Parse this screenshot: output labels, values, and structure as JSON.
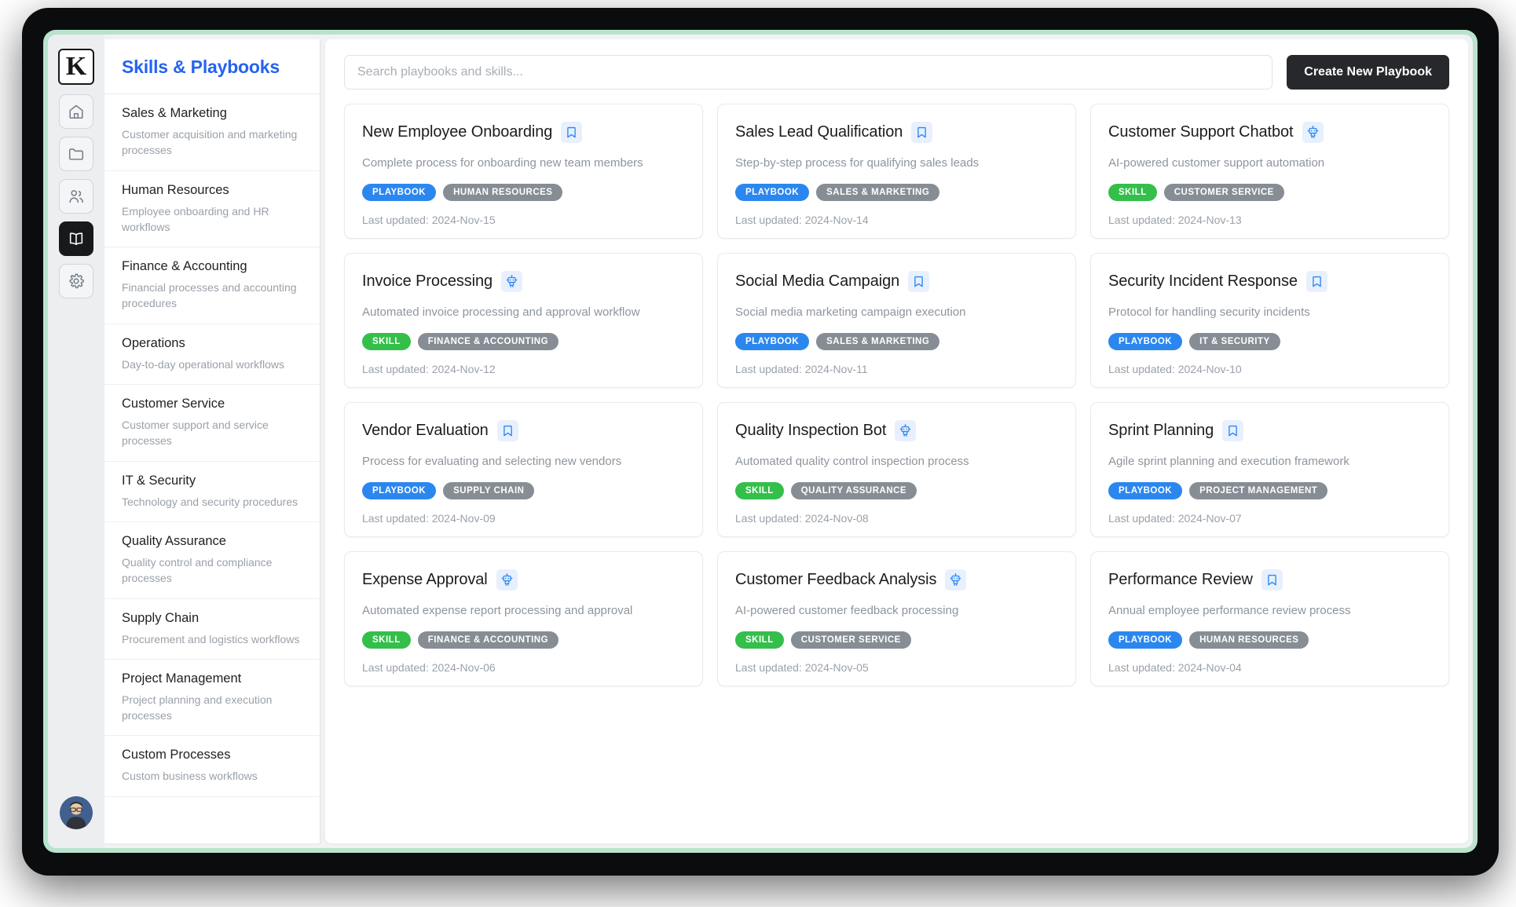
{
  "app": {
    "logo_letter": "K",
    "accent_blue": "#2563f0",
    "badge_playbook_color": "#2b87ef",
    "badge_skill_color": "#34bf4b",
    "badge_category_color": "#868d95",
    "frame_accent": "#b9e3cd"
  },
  "rail": {
    "items": [
      {
        "name": "home-icon",
        "label": "Home"
      },
      {
        "name": "folder-icon",
        "label": "Files"
      },
      {
        "name": "people-icon",
        "label": "Team"
      },
      {
        "name": "book-icon",
        "label": "Playbooks",
        "active": true
      },
      {
        "name": "gear-icon",
        "label": "Settings"
      }
    ],
    "avatar_label": "User profile"
  },
  "sidebar": {
    "title": "Skills & Playbooks",
    "items": [
      {
        "label": "Sales & Marketing",
        "desc": "Customer acquisition and marketing processes"
      },
      {
        "label": "Human Resources",
        "desc": "Employee onboarding and HR workflows"
      },
      {
        "label": "Finance & Accounting",
        "desc": "Financial processes and accounting procedures"
      },
      {
        "label": "Operations",
        "desc": "Day-to-day operational workflows"
      },
      {
        "label": "Customer Service",
        "desc": "Customer support and service processes"
      },
      {
        "label": "IT & Security",
        "desc": "Technology and security procedures"
      },
      {
        "label": "Quality Assurance",
        "desc": "Quality control and compliance processes"
      },
      {
        "label": "Supply Chain",
        "desc": "Procurement and logistics workflows"
      },
      {
        "label": "Project Management",
        "desc": "Project planning and execution processes"
      },
      {
        "label": "Custom Processes",
        "desc": "Custom business workflows"
      }
    ]
  },
  "toolbar": {
    "search_placeholder": "Search playbooks and skills...",
    "search_value": "",
    "create_label": "Create New Playbook"
  },
  "cards": [
    {
      "title": "New Employee Onboarding",
      "desc": "Complete process for onboarding new team members",
      "icon": "bookmark-icon",
      "type_badge": "PLAYBOOK",
      "type": "playbook",
      "category_badge": "HUMAN RESOURCES",
      "updated": "Last updated: 2024-Nov-15"
    },
    {
      "title": "Sales Lead Qualification",
      "desc": "Step-by-step process for qualifying sales leads",
      "icon": "bookmark-icon",
      "type_badge": "PLAYBOOK",
      "type": "playbook",
      "category_badge": "SALES & MARKETING",
      "updated": "Last updated: 2024-Nov-14"
    },
    {
      "title": "Customer Support Chatbot",
      "desc": "AI-powered customer support automation",
      "icon": "robot-icon",
      "type_badge": "SKILL",
      "type": "skill",
      "category_badge": "CUSTOMER SERVICE",
      "updated": "Last updated: 2024-Nov-13"
    },
    {
      "title": "Invoice Processing",
      "desc": "Automated invoice processing and approval workflow",
      "icon": "robot-icon",
      "type_badge": "SKILL",
      "type": "skill",
      "category_badge": "FINANCE & ACCOUNTING",
      "updated": "Last updated: 2024-Nov-12"
    },
    {
      "title": "Social Media Campaign",
      "desc": "Social media marketing campaign execution",
      "icon": "bookmark-icon",
      "type_badge": "PLAYBOOK",
      "type": "playbook",
      "category_badge": "SALES & MARKETING",
      "updated": "Last updated: 2024-Nov-11"
    },
    {
      "title": "Security Incident Response",
      "desc": "Protocol for handling security incidents",
      "icon": "bookmark-icon",
      "type_badge": "PLAYBOOK",
      "type": "playbook",
      "category_badge": "IT & SECURITY",
      "updated": "Last updated: 2024-Nov-10"
    },
    {
      "title": "Vendor Evaluation",
      "desc": "Process for evaluating and selecting new vendors",
      "icon": "bookmark-icon",
      "type_badge": "PLAYBOOK",
      "type": "playbook",
      "category_badge": "SUPPLY CHAIN",
      "updated": "Last updated: 2024-Nov-09"
    },
    {
      "title": "Quality Inspection Bot",
      "desc": "Automated quality control inspection process",
      "icon": "robot-icon",
      "type_badge": "SKILL",
      "type": "skill",
      "category_badge": "QUALITY ASSURANCE",
      "updated": "Last updated: 2024-Nov-08"
    },
    {
      "title": "Sprint Planning",
      "desc": "Agile sprint planning and execution framework",
      "icon": "bookmark-icon",
      "type_badge": "PLAYBOOK",
      "type": "playbook",
      "category_badge": "PROJECT MANAGEMENT",
      "updated": "Last updated: 2024-Nov-07"
    },
    {
      "title": "Expense Approval",
      "desc": "Automated expense report processing and approval",
      "icon": "robot-icon",
      "type_badge": "SKILL",
      "type": "skill",
      "category_badge": "FINANCE & ACCOUNTING",
      "updated": "Last updated: 2024-Nov-06"
    },
    {
      "title": "Customer Feedback Analysis",
      "desc": "AI-powered customer feedback processing",
      "icon": "robot-icon",
      "type_badge": "SKILL",
      "type": "skill",
      "category_badge": "CUSTOMER SERVICE",
      "updated": "Last updated: 2024-Nov-05"
    },
    {
      "title": "Performance Review",
      "desc": "Annual employee performance review process",
      "icon": "bookmark-icon",
      "type_badge": "PLAYBOOK",
      "type": "playbook",
      "category_badge": "HUMAN RESOURCES",
      "updated": "Last updated: 2024-Nov-04"
    }
  ]
}
